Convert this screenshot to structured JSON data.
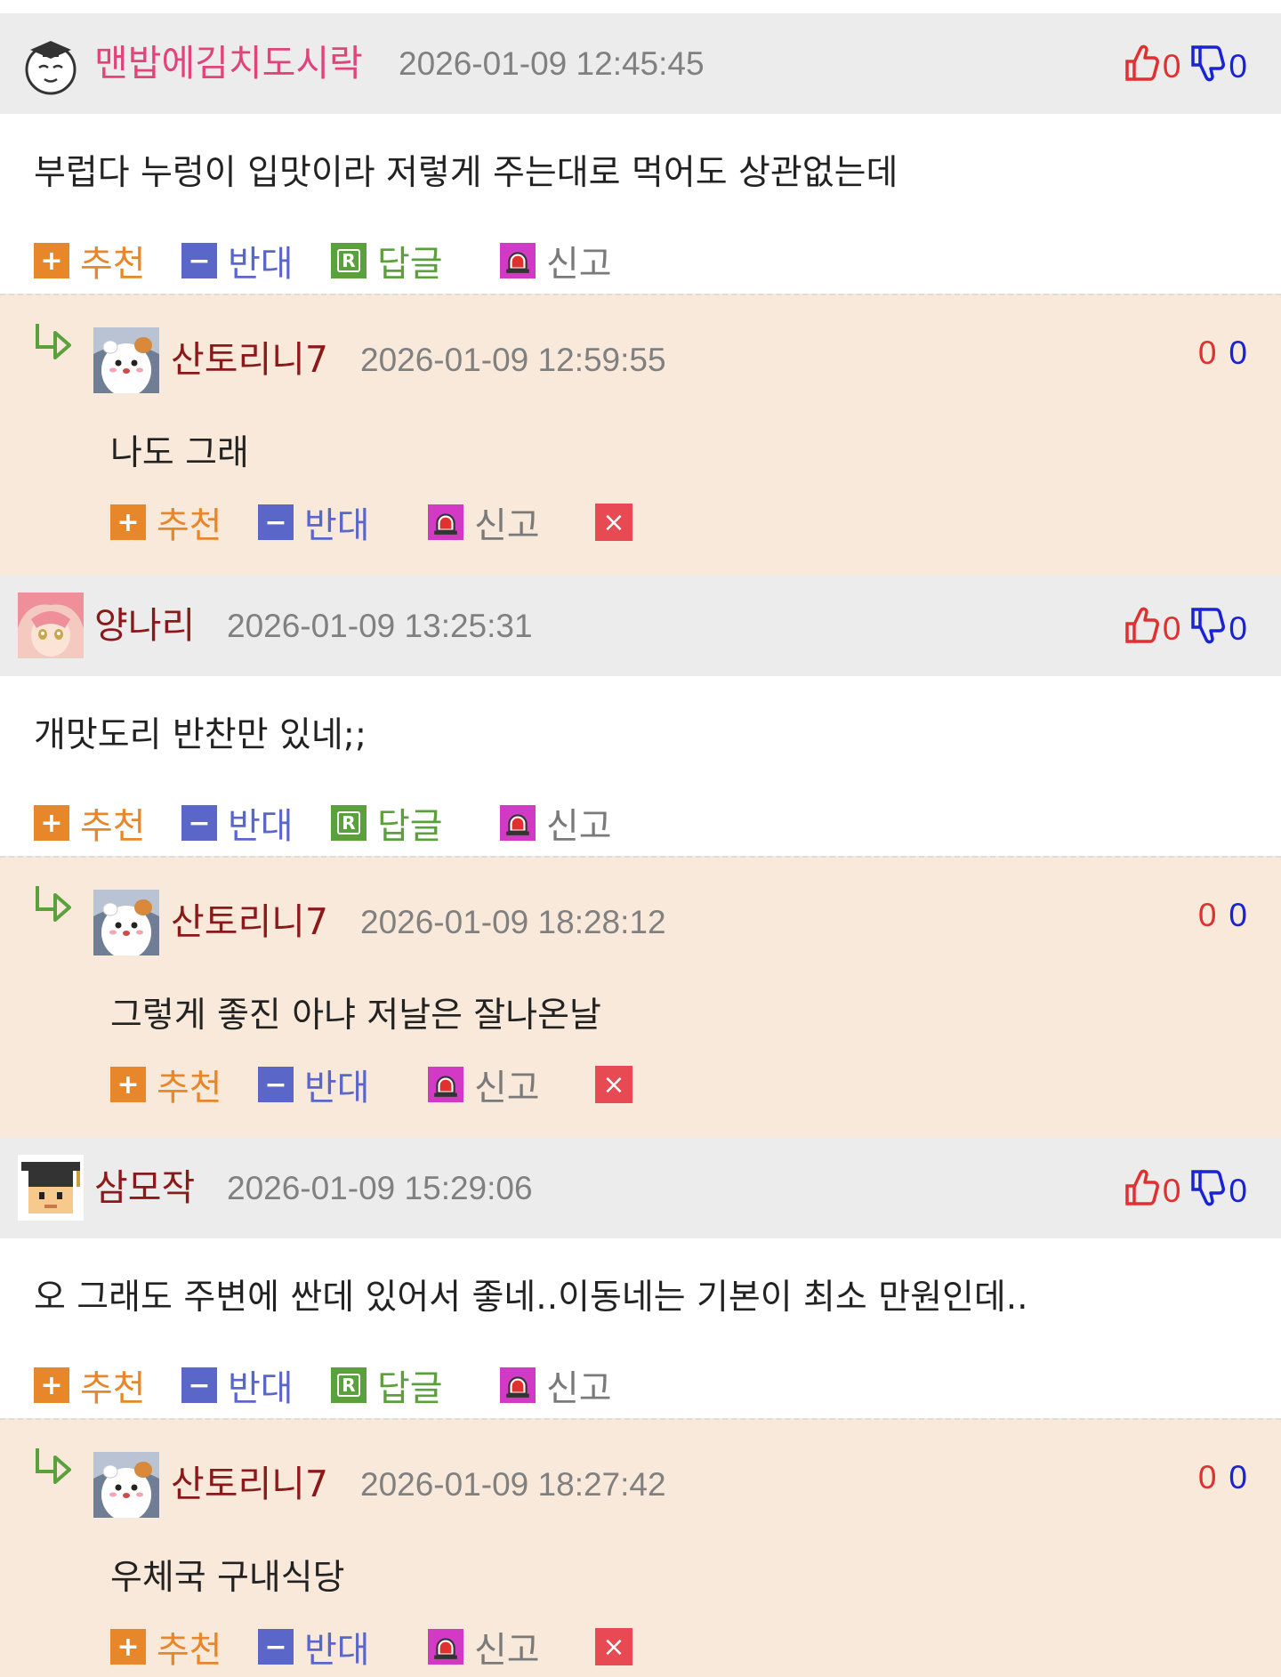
{
  "labels": {
    "recommend": "추천",
    "oppose": "반대",
    "reply": "답글",
    "report": "신고",
    "delete": "×",
    "plus": "+",
    "minus": "−",
    "reply_badge": "R"
  },
  "colors": {
    "header_bg": "#ececec",
    "reply_bg": "#f8e9da",
    "recommend": "#e8862a",
    "oppose": "#5a67c8",
    "reply": "#5aa03c",
    "report_icon": "#d23ac6",
    "delete": "#e74a52",
    "up_vote": "#e03030",
    "down_vote": "#1a22d6"
  },
  "comments": [
    {
      "author": "맨밥에김치도시락",
      "author_color": "#e0447a",
      "avatar_icon": "graduate-face-avatar",
      "datetime": "2026-01-09 12:45:45",
      "up": "0",
      "down": "0",
      "text": "부럽다 누렁이 입맛이라 저렇게 주는대로 먹어도 상관없는데",
      "reply": {
        "author": "산토리니7",
        "author_color": "#8a1a1a",
        "avatar_icon": "hamster-avatar",
        "datetime": "2026-01-09 12:59:55",
        "up": "0",
        "down": "0",
        "text": "나도 그래"
      }
    },
    {
      "author": "양나리",
      "author_color": "#8a1a1a",
      "avatar_icon": "anime-girl-avatar",
      "datetime": "2026-01-09 13:25:31",
      "up": "0",
      "down": "0",
      "text": "개맛도리 반찬만 있네;;",
      "reply": {
        "author": "산토리니7",
        "author_color": "#8a1a1a",
        "avatar_icon": "hamster-avatar",
        "datetime": "2026-01-09 18:28:12",
        "up": "0",
        "down": "0",
        "text": "그렇게 좋진 아냐 저날은 잘나온날"
      }
    },
    {
      "author": "삼모작",
      "author_color": "#8a1a1a",
      "avatar_icon": "pixel-graduate-avatar",
      "datetime": "2026-01-09 15:29:06",
      "up": "0",
      "down": "0",
      "text": "오 그래도 주변에 싼데 있어서 좋네..이동네는 기본이 최소 만원인데..",
      "reply": {
        "author": "산토리니7",
        "author_color": "#8a1a1a",
        "avatar_icon": "hamster-avatar",
        "datetime": "2026-01-09 18:27:42",
        "up": "0",
        "down": "0",
        "text": "우체국 구내식당"
      }
    }
  ]
}
